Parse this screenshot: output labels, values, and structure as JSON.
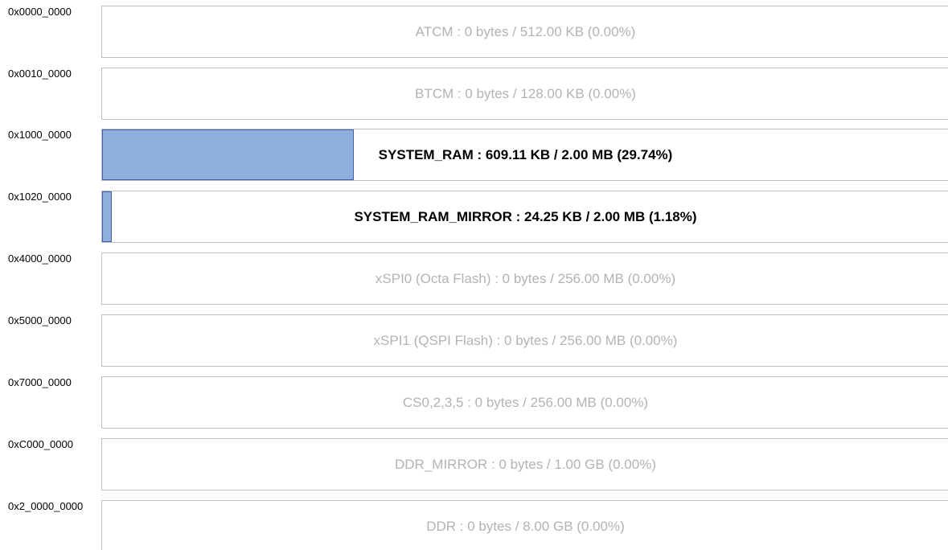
{
  "regions": [
    {
      "address": "0x0000_0000",
      "label": "ATCM : 0 bytes / 512.00 KB (0.00%)",
      "usage_fraction": 0.0,
      "used": false
    },
    {
      "address": "0x0010_0000",
      "label": "BTCM : 0 bytes / 128.00 KB (0.00%)",
      "usage_fraction": 0.0,
      "used": false
    },
    {
      "address": "0x1000_0000",
      "label": "SYSTEM_RAM : 609.11 KB / 2.00 MB (29.74%)",
      "usage_fraction": 0.2974,
      "used": true
    },
    {
      "address": "0x1020_0000",
      "label": "SYSTEM_RAM_MIRROR : 24.25 KB / 2.00 MB (1.18%)",
      "usage_fraction": 0.0118,
      "used": true
    },
    {
      "address": "0x4000_0000",
      "label": "xSPI0 (Octa Flash) : 0 bytes / 256.00 MB (0.00%)",
      "usage_fraction": 0.0,
      "used": false
    },
    {
      "address": "0x5000_0000",
      "label": "xSPI1 (QSPI Flash) : 0 bytes / 256.00 MB (0.00%)",
      "usage_fraction": 0.0,
      "used": false
    },
    {
      "address": "0x7000_0000",
      "label": "CS0,2,3,5 : 0 bytes / 256.00 MB (0.00%)",
      "usage_fraction": 0.0,
      "used": false
    },
    {
      "address": "0xC000_0000",
      "label": "DDR_MIRROR : 0 bytes / 1.00 GB (0.00%)",
      "usage_fraction": 0.0,
      "used": false
    },
    {
      "address": "0x2_0000_0000",
      "label": "DDR : 0 bytes / 8.00 GB (0.00%)",
      "usage_fraction": 0.0,
      "used": false
    }
  ],
  "colors": {
    "fill": "#8eaedc",
    "fill_border": "#3f5fa8",
    "box_border": "#c0c0c0",
    "unused_text": "#b3b3b3",
    "used_text": "#000000"
  }
}
